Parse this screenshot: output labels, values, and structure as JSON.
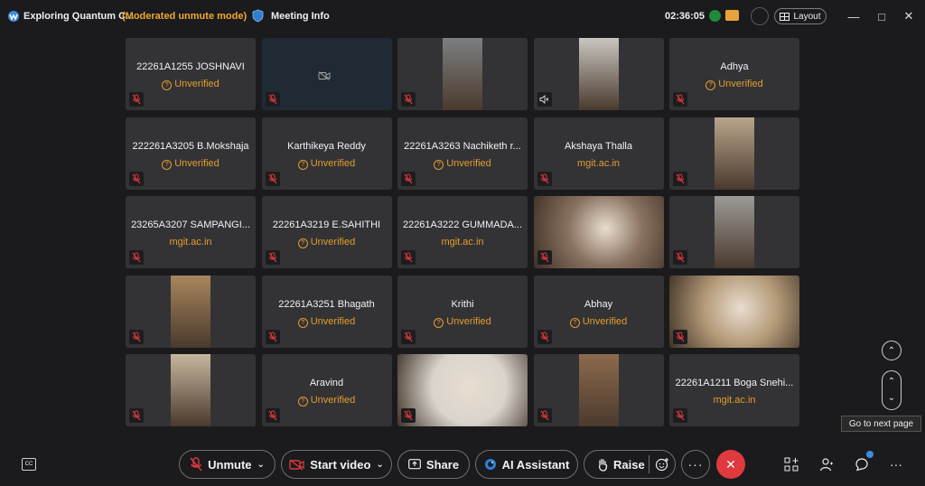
{
  "titlebar": {
    "meeting_title": "Exploring Quantum C...",
    "mode": "(Moderated unmute mode)",
    "meeting_info": "Meeting Info",
    "timer": "02:36:05",
    "layout_label": "Layout"
  },
  "tiles": [
    {
      "name": "22261A1255 JOSHNAVI",
      "sub": "Unverified",
      "kind": "unverified"
    },
    {
      "name": "",
      "sub": "",
      "kind": "camoff"
    },
    {
      "name": "",
      "sub": "",
      "kind": "video",
      "color": "#7c7f80"
    },
    {
      "name": "",
      "sub": "",
      "kind": "video",
      "color": "#c9c6bf",
      "audio": "speaker"
    },
    {
      "name": "Adhya",
      "sub": "Unverified",
      "kind": "unverified"
    },
    {
      "name": "222261A3205 B.Mokshaja",
      "sub": "Unverified",
      "kind": "unverified"
    },
    {
      "name": "Karthikeya  Reddy",
      "sub": "Unverified",
      "kind": "unverified"
    },
    {
      "name": "22261A3263 Nachiketh r...",
      "sub": "Unverified",
      "kind": "unverified"
    },
    {
      "name": "Akshaya Thalla",
      "sub": "mgit.ac.in",
      "kind": "domain"
    },
    {
      "name": "",
      "sub": "",
      "kind": "video",
      "color": "#b9a58c"
    },
    {
      "name": "23265A3207 SAMPANGI...",
      "sub": "mgit.ac.in",
      "kind": "domain"
    },
    {
      "name": "22261A3219 E.SAHITHI",
      "sub": "Unverified",
      "kind": "unverified"
    },
    {
      "name": "22261A3222 GUMMADA...",
      "sub": "mgit.ac.in",
      "kind": "domain"
    },
    {
      "name": "",
      "sub": "",
      "kind": "videofull",
      "color": "#8a7260"
    },
    {
      "name": "",
      "sub": "",
      "kind": "video",
      "color": "#9c9a96"
    },
    {
      "name": "",
      "sub": "",
      "kind": "video",
      "color": "#a7865c"
    },
    {
      "name": "22261A3251 Bhagath",
      "sub": "Unverified",
      "kind": "unverified"
    },
    {
      "name": "Krithi",
      "sub": "Unverified",
      "kind": "unverified"
    },
    {
      "name": "Abhay",
      "sub": "Unverified",
      "kind": "unverified"
    },
    {
      "name": "",
      "sub": "",
      "kind": "videofull",
      "color": "#b49a78"
    },
    {
      "name": "",
      "sub": "",
      "kind": "video",
      "color": "#c7b79e"
    },
    {
      "name": "Aravind",
      "sub": "Unverified",
      "kind": "unverified"
    },
    {
      "name": "",
      "sub": "",
      "kind": "videofull",
      "color": "#d9d4cc"
    },
    {
      "name": "",
      "sub": "",
      "kind": "video",
      "color": "#8d6a4d"
    },
    {
      "name": "22261A1211 Boga Snehi...",
      "sub": "mgit.ac.in",
      "kind": "domain"
    }
  ],
  "pager": {
    "tooltip": "Go to next page"
  },
  "controls": {
    "unmute": "Unmute",
    "start_video": "Start video",
    "share": "Share",
    "ai_assistant": "AI Assistant",
    "raise": "Raise"
  },
  "colors": {
    "accent_orange": "#e49c2b",
    "end_red": "#e0393e",
    "info_blue": "#3a8de0"
  }
}
